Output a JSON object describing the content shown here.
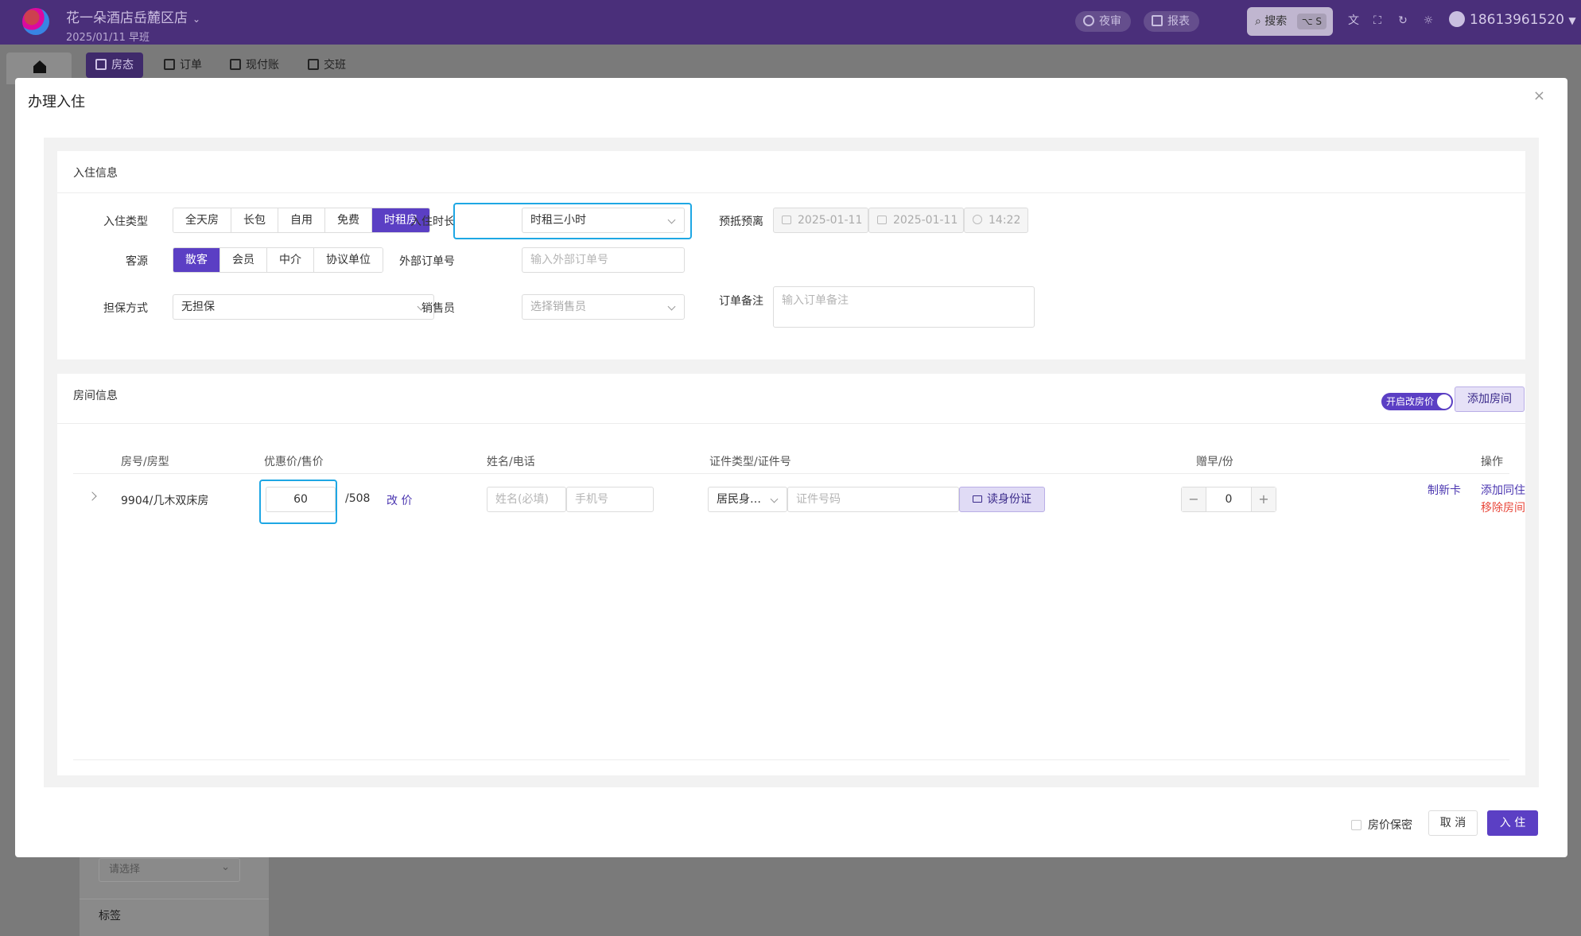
{
  "app": {
    "hotel_name": "花一朵酒店岳麓区店",
    "date_shift": "2025/01/11   早班",
    "night_audit": "夜审",
    "reports": "报表",
    "search_label": "搜索",
    "search_shortcut": "⌥ S",
    "user_phone": "18613961520",
    "tabs": [
      {
        "label": "房态"
      },
      {
        "label": "订单"
      },
      {
        "label": "现付账"
      },
      {
        "label": "交班"
      }
    ],
    "bg_select_placeholder": "请选择",
    "bg_tag_label": "标签"
  },
  "modal": {
    "title": "办理入住",
    "close": "×"
  },
  "checkin_info": {
    "title": "入住信息",
    "type_label": "入住类型",
    "types": [
      "全天房",
      "长包",
      "自用",
      "免费",
      "时租房"
    ],
    "type_selected": "时租房",
    "duration_label": "入住时长",
    "duration_value": "时租三小时",
    "estimate_label": "预抵预离",
    "arrive_date": "2025-01-11",
    "depart_date": "2025-01-11",
    "depart_time": "14:22",
    "source_label": "客源",
    "sources": [
      "散客",
      "会员",
      "中介",
      "协议单位"
    ],
    "source_selected": "散客",
    "ext_order_label": "外部订单号",
    "ext_order_placeholder": "输入外部订单号",
    "guarantee_label": "担保方式",
    "guarantee_value": "无担保",
    "sales_label": "销售员",
    "sales_placeholder": "选择销售员",
    "remark_label": "订单备注",
    "remark_placeholder": "输入订单备注"
  },
  "room_info": {
    "title": "房间信息",
    "price_toggle_label": "开启改房价",
    "add_room_label": "添加房间",
    "columns": [
      "房号/房型",
      "优惠价/售价",
      "姓名/电话",
      "证件类型/证件号",
      "赠早/份",
      "操作"
    ],
    "rows": [
      {
        "room": "9904/几木双床房",
        "discount_price": "60",
        "sale_price": "/508",
        "change_price": "改 价",
        "name_placeholder": "姓名(必填)",
        "phone_placeholder": "手机号",
        "id_type": "居民身…",
        "id_placeholder": "证件号码",
        "read_id_label": "读身份证",
        "breakfast": "0",
        "actions": {
          "make_card": "制新卡",
          "add_guest": "添加同住",
          "remove_room": "移除房间"
        }
      }
    ]
  },
  "footer": {
    "price_secret_label": "房价保密",
    "cancel_label": "取 消",
    "checkin_label": "入 住"
  },
  "colors": {
    "primary": "#5b3fc4",
    "highlight": "#1ea7e4",
    "danger": "#e8473a",
    "topbar": "#4a2f7a"
  }
}
